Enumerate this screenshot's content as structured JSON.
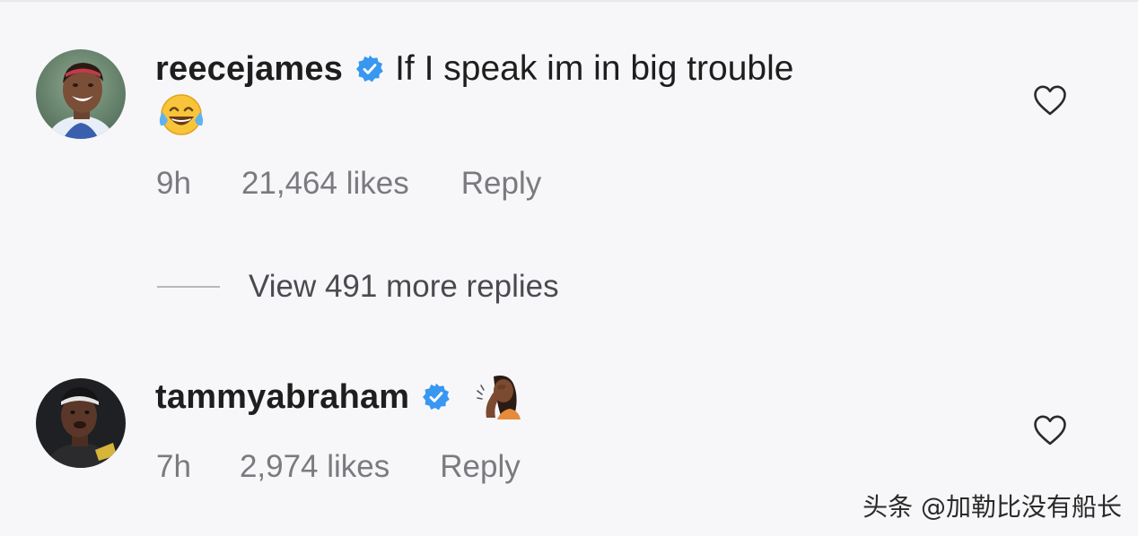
{
  "comments": [
    {
      "username": "reecejames",
      "verified": true,
      "text": "If I speak im in big trouble",
      "emoji": "😂",
      "emoji_name": "face-with-tears-of-joy",
      "time": "9h",
      "likes": "21,464 likes",
      "reply": "Reply"
    },
    {
      "username": "tammyabraham",
      "verified": true,
      "text": "",
      "emoji": "🤦🏾‍♀️",
      "emoji_name": "woman-facepalming",
      "time": "7h",
      "likes": "2,974 likes",
      "reply": "Reply"
    }
  ],
  "view_more_replies": "View 491 more replies",
  "watermark": "头条 @加勒比没有船长",
  "colors": {
    "background": "#f7f7f9",
    "verified_badge": "#3897f0",
    "meta_text": "#7a7a7f",
    "text": "#1e1e1e"
  },
  "icons": {
    "verified": "verified-badge-icon",
    "like": "heart-outline-icon"
  }
}
